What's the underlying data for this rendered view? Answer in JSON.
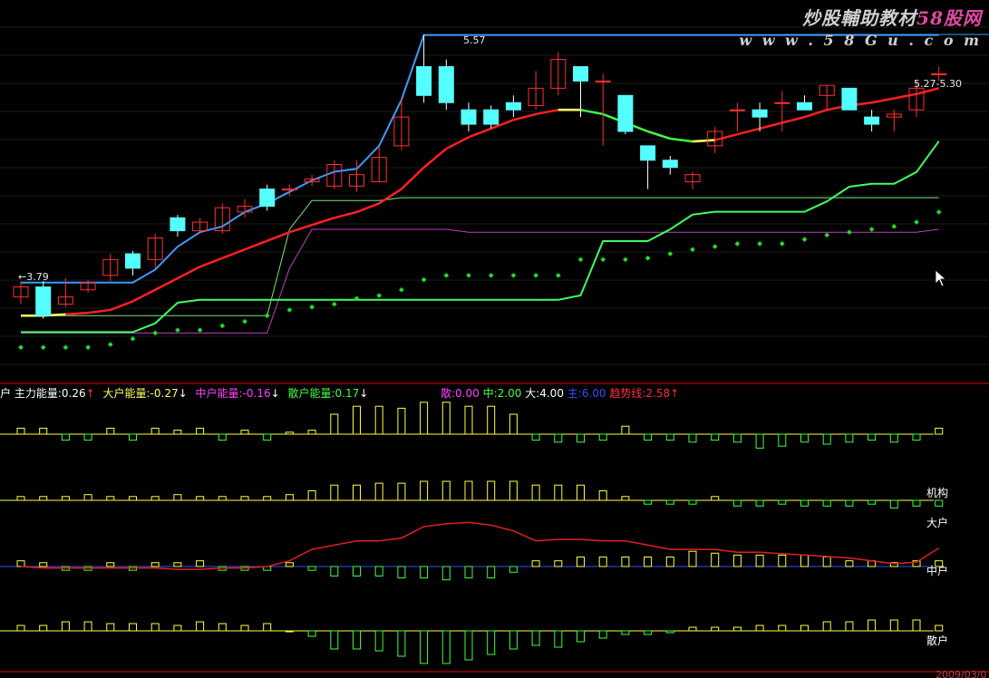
{
  "watermark": {
    "line1a": "炒股輔助教材",
    "line1b": "58股网",
    "line2": "w w w . 5 8 G u . c o m"
  },
  "colors": {
    "up": "#ff3030",
    "down": "#54ffff",
    "boll_upper": "#3a9cff",
    "ma": "#ff2020",
    "dots": "#20e020",
    "energy": "#ffff40",
    "neg": "#40ff40",
    "frame": "#a00000"
  },
  "price_labels": {
    "high": "5.57",
    "low": "←3.79",
    "range": "5.27-5.30"
  },
  "legend": {
    "prefix": "户",
    "main_force": "主力能量:0.26",
    "big": "大户能量:-0.27",
    "middle": "中户能量:-0.16",
    "retail": "散户能量:0.17",
    "s": "散:0.00",
    "z": "中:2.00",
    "d": "大:4.00",
    "j": "主:6.00",
    "trend": "趋势线:2.58"
  },
  "pane_labels": {
    "inst": "机构",
    "big": "大户",
    "middle": "中户",
    "retail": "散户"
  },
  "date_label": "2009/03/0",
  "chart_data": {
    "type": "candlestick",
    "count": 42,
    "ylim": [
      3.2,
      5.75
    ],
    "candles": [
      [
        3.75,
        3.82,
        3.7,
        3.86
      ],
      [
        3.82,
        3.62,
        3.6,
        3.86
      ],
      [
        3.7,
        3.75,
        3.68,
        3.88
      ],
      [
        3.8,
        3.85,
        3.78,
        3.87
      ],
      [
        3.9,
        4.01,
        3.86,
        4.05
      ],
      [
        4.05,
        3.95,
        3.9,
        4.07
      ],
      [
        4.01,
        4.16,
        3.95,
        4.19
      ],
      [
        4.3,
        4.21,
        4.17,
        4.32
      ],
      [
        4.21,
        4.27,
        4.19,
        4.3
      ],
      [
        4.21,
        4.37,
        4.19,
        4.4
      ],
      [
        4.34,
        4.38,
        4.3,
        4.43
      ],
      [
        4.5,
        4.38,
        4.35,
        4.53
      ],
      [
        4.5,
        4.5,
        4.45,
        4.53
      ],
      [
        4.55,
        4.57,
        4.52,
        4.6
      ],
      [
        4.52,
        4.67,
        4.5,
        4.7
      ],
      [
        4.52,
        4.6,
        4.48,
        4.7
      ],
      [
        4.55,
        4.72,
        4.55,
        4.8
      ],
      [
        4.8,
        5.0,
        4.77,
        5.14
      ],
      [
        5.35,
        5.15,
        5.1,
        5.57
      ],
      [
        5.35,
        5.1,
        5.05,
        5.4
      ],
      [
        5.05,
        4.95,
        4.9,
        5.1
      ],
      [
        5.05,
        4.95,
        4.92,
        5.08
      ],
      [
        5.1,
        5.05,
        5.0,
        5.15
      ],
      [
        5.08,
        5.2,
        5.05,
        5.32
      ],
      [
        5.2,
        5.4,
        5.15,
        5.45
      ],
      [
        5.35,
        5.25,
        5.0,
        5.35
      ],
      [
        5.25,
        5.25,
        4.8,
        5.3
      ],
      [
        5.15,
        4.9,
        4.88,
        5.15
      ],
      [
        4.8,
        4.7,
        4.5,
        4.8
      ],
      [
        4.7,
        4.65,
        4.6,
        4.73
      ],
      [
        4.55,
        4.6,
        4.5,
        4.62
      ],
      [
        4.8,
        4.9,
        4.75,
        4.93
      ],
      [
        5.05,
        5.05,
        4.9,
        5.1
      ],
      [
        5.05,
        5.0,
        4.9,
        5.1
      ],
      [
        5.1,
        5.1,
        4.9,
        5.18
      ],
      [
        5.1,
        5.05,
        5.05,
        5.15
      ],
      [
        5.15,
        5.22,
        5.05,
        5.22
      ],
      [
        5.2,
        5.05,
        5.05,
        5.2
      ],
      [
        5.0,
        4.95,
        4.9,
        5.05
      ],
      [
        5.0,
        5.02,
        4.9,
        5.05
      ],
      [
        5.05,
        5.2,
        5.0,
        5.25
      ],
      [
        5.3,
        5.3,
        5.25,
        5.35
      ]
    ],
    "ma": [
      3.62,
      3.62,
      3.63,
      3.64,
      3.66,
      3.72,
      3.8,
      3.88,
      3.96,
      4.02,
      4.08,
      4.14,
      4.2,
      4.25,
      4.3,
      4.34,
      4.4,
      4.5,
      4.65,
      4.78,
      4.86,
      4.92,
      4.98,
      5.02,
      5.05,
      5.05,
      5.02,
      4.96,
      4.9,
      4.85,
      4.83,
      4.84,
      4.88,
      4.92,
      4.96,
      5.0,
      5.05,
      5.08,
      5.1,
      5.13,
      5.16,
      5.2
    ],
    "upper": [
      3.85,
      3.85,
      3.85,
      3.85,
      3.85,
      3.85,
      3.94,
      4.1,
      4.2,
      4.24,
      4.34,
      4.4,
      4.48,
      4.56,
      4.62,
      4.64,
      4.8,
      5.12,
      5.57,
      5.57,
      5.57,
      5.57,
      5.57,
      5.57,
      5.57,
      5.57,
      5.57,
      5.57,
      5.57,
      5.57,
      5.57,
      5.57,
      5.57,
      5.57,
      5.57,
      5.57,
      5.57,
      5.57,
      5.57,
      5.57,
      5.57,
      5.57
    ],
    "channel_lo_magenta": [
      3.5,
      3.5,
      3.5,
      3.5,
      3.5,
      3.5,
      3.5,
      3.5,
      3.5,
      3.5,
      3.5,
      3.5,
      3.95,
      4.22,
      4.22,
      4.22,
      4.22,
      4.22,
      4.22,
      4.22,
      4.2,
      4.2,
      4.2,
      4.2,
      4.2,
      4.2,
      4.2,
      4.2,
      4.2,
      4.2,
      4.2,
      4.2,
      4.2,
      4.2,
      4.2,
      4.2,
      4.2,
      4.2,
      4.2,
      4.2,
      4.2,
      4.22
    ],
    "channel_lo_green": [
      3.62,
      3.62,
      3.62,
      3.62,
      3.62,
      3.62,
      3.62,
      3.62,
      3.62,
      3.62,
      3.62,
      3.62,
      4.22,
      4.42,
      4.42,
      4.42,
      4.42,
      4.44,
      4.44,
      4.44,
      4.44,
      4.44,
      4.44,
      4.44,
      4.44,
      4.44,
      4.44,
      4.44,
      4.44,
      4.44,
      4.44,
      4.44,
      4.44,
      4.44,
      4.44,
      4.44,
      4.44,
      4.44,
      4.44,
      4.44,
      4.44,
      4.44
    ],
    "sar": [
      3.4,
      3.4,
      3.4,
      3.4,
      3.42,
      3.46,
      3.5,
      3.52,
      3.52,
      3.55,
      3.58,
      3.62,
      3.66,
      3.68,
      3.7,
      3.74,
      3.76,
      3.8,
      3.87,
      3.9,
      3.9,
      3.9,
      3.9,
      3.9,
      3.9,
      4.01,
      4.01,
      4.01,
      4.02,
      4.05,
      4.08,
      4.1,
      4.12,
      4.12,
      4.12,
      4.15,
      4.18,
      4.2,
      4.22,
      4.24,
      4.27,
      4.34
    ],
    "trend": [
      1.0,
      1.0,
      1.0,
      1.0,
      1.0,
      1.0,
      1.06,
      1.2,
      1.22,
      1.22,
      1.22,
      1.22,
      1.22,
      1.22,
      1.22,
      1.22,
      1.22,
      1.22,
      1.22,
      1.22,
      1.22,
      1.22,
      1.22,
      1.22,
      1.22,
      1.25,
      1.62,
      1.62,
      1.62,
      1.7,
      1.8,
      1.82,
      1.82,
      1.82,
      1.82,
      1.82,
      1.89,
      1.99,
      2.01,
      2.01,
      2.09,
      2.3
    ],
    "trend_ylim": [
      0.7,
      3.2
    ],
    "energy": [
      0.3,
      0.3,
      -0.3,
      -0.3,
      0.3,
      -0.3,
      0.3,
      0.2,
      0.3,
      -0.3,
      0.2,
      -0.3,
      0.1,
      0.2,
      1.0,
      1.4,
      1.4,
      1.3,
      1.6,
      1.6,
      1.4,
      1.4,
      1.0,
      -0.3,
      -0.4,
      -0.4,
      -0.3,
      0.4,
      -0.3,
      -0.3,
      -0.4,
      -0.3,
      -0.4,
      -0.7,
      -0.6,
      -0.4,
      -0.5,
      -0.4,
      -0.3,
      -0.4,
      -0.3,
      0.3
    ],
    "inst": [
      0.2,
      0.2,
      0.2,
      0.3,
      0.2,
      0.2,
      0.2,
      0.3,
      0.2,
      0.2,
      0.2,
      0.2,
      0.3,
      0.5,
      0.8,
      0.8,
      0.9,
      0.9,
      1.0,
      1.0,
      1.0,
      1.0,
      1.0,
      0.8,
      0.8,
      0.8,
      0.5,
      0.2,
      -0.2,
      -0.2,
      -0.2,
      0.2,
      -0.3,
      -0.3,
      -0.2,
      -0.3,
      -0.3,
      -0.3,
      -0.2,
      -0.4,
      -0.3,
      -0.3
    ],
    "mid": [
      0.3,
      0.2,
      -0.2,
      -0.2,
      0.2,
      -0.2,
      0.2,
      0.2,
      0.3,
      -0.2,
      -0.2,
      -0.2,
      0.2,
      -0.2,
      -0.5,
      -0.5,
      -0.5,
      -0.6,
      -0.6,
      -0.7,
      -0.6,
      -0.6,
      -0.3,
      0.3,
      0.3,
      0.5,
      0.5,
      0.5,
      0.5,
      0.5,
      0.8,
      0.7,
      0.6,
      0.6,
      0.6,
      0.6,
      0.5,
      0.3,
      0.3,
      0.2,
      0.3,
      0.3
    ],
    "mid_line": [
      0.0,
      -0.1,
      -0.1,
      -0.1,
      -0.1,
      -0.1,
      -0.1,
      -0.2,
      -0.2,
      -0.1,
      -0.1,
      0.0,
      0.4,
      1.2,
      1.5,
      1.8,
      1.8,
      2.0,
      2.8,
      3.0,
      3.1,
      2.9,
      2.5,
      1.8,
      1.9,
      1.9,
      1.8,
      1.8,
      1.5,
      1.2,
      1.2,
      1.2,
      1.0,
      1.0,
      0.9,
      0.8,
      0.7,
      0.6,
      0.4,
      0.2,
      0.3,
      1.3
    ],
    "mid_ylim": [
      -0.7,
      3.5
    ],
    "retail": [
      0.3,
      0.3,
      0.5,
      0.5,
      0.4,
      0.4,
      0.4,
      0.3,
      0.5,
      0.4,
      0.3,
      0.4,
      0.0,
      -0.3,
      -1.0,
      -1.0,
      -1.1,
      -1.4,
      -1.8,
      -1.8,
      -1.6,
      -1.3,
      -1.0,
      -0.8,
      -0.9,
      -0.6,
      -0.4,
      -0.2,
      -0.2,
      -0.1,
      0.2,
      0.2,
      0.2,
      0.3,
      0.3,
      0.3,
      0.5,
      0.5,
      0.6,
      0.6,
      0.6,
      0.3
    ]
  }
}
